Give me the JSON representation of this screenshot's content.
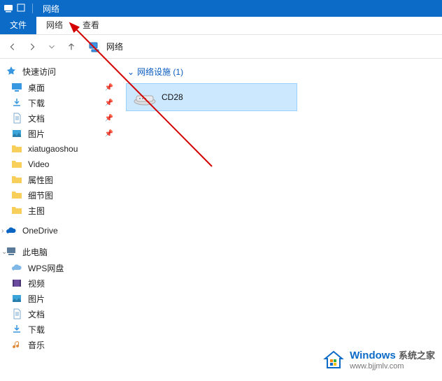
{
  "titlebar": {
    "title": "网络"
  },
  "ribbon": {
    "file": "文件",
    "tabs": [
      "网络",
      "查看"
    ]
  },
  "address": {
    "location": "网络"
  },
  "sidebar": {
    "quick_access": {
      "label": "快速访问",
      "items": [
        {
          "label": "桌面",
          "pinned": true,
          "icon": "desktop"
        },
        {
          "label": "下载",
          "pinned": true,
          "icon": "download"
        },
        {
          "label": "文档",
          "pinned": true,
          "icon": "document"
        },
        {
          "label": "图片",
          "pinned": true,
          "icon": "pictures"
        },
        {
          "label": "xiatugaoshou",
          "pinned": false,
          "icon": "folder"
        },
        {
          "label": "Video",
          "pinned": false,
          "icon": "folder"
        },
        {
          "label": "属性图",
          "pinned": false,
          "icon": "folder"
        },
        {
          "label": "细节图",
          "pinned": false,
          "icon": "folder"
        },
        {
          "label": "主图",
          "pinned": false,
          "icon": "folder"
        }
      ]
    },
    "onedrive": {
      "label": "OneDrive"
    },
    "this_pc": {
      "label": "此电脑",
      "items": [
        {
          "label": "WPS网盘",
          "icon": "cloud"
        },
        {
          "label": "视频",
          "icon": "videos"
        },
        {
          "label": "图片",
          "icon": "pictures"
        },
        {
          "label": "文档",
          "icon": "document"
        },
        {
          "label": "下载",
          "icon": "download"
        },
        {
          "label": "音乐",
          "icon": "music"
        }
      ]
    }
  },
  "main": {
    "section_header": "网络设施 (1)",
    "devices": [
      {
        "name": "CD28"
      }
    ]
  },
  "watermark": {
    "brand": "Windows",
    "sub": "系统之家",
    "url": "www.bjjmlv.com"
  }
}
